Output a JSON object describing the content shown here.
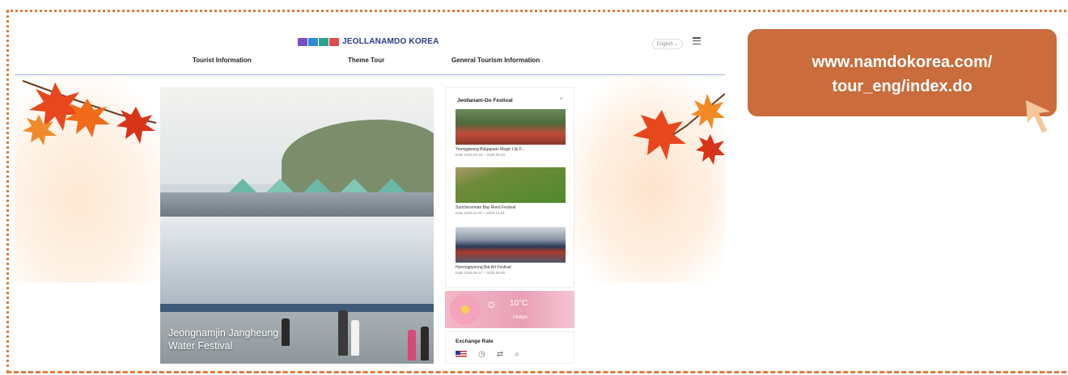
{
  "header": {
    "logo_text": "JEOLLANAMDO KOREA",
    "language": "English ⌄",
    "nav": [
      "Tourist Information",
      "Theme Tour",
      "General Tourism Information"
    ]
  },
  "hero": {
    "caption_line1": "Jeongnamjin Jangheung",
    "caption_line2": "Water Festival"
  },
  "festival": {
    "title": "Jeollanam-Do Festival",
    "plus": "+",
    "items": [
      {
        "name": "Yeonggwang Bulgapsan Magic Lily F...",
        "date": "Date 2025.09.18 ~ 2025.09.24"
      },
      {
        "name": "Suncheonman Bay Reed Festival",
        "date": "Date 2025.11.02 ~ 2025.12.04"
      },
      {
        "name": "Hyeongpyeong Bat Art Festival",
        "date": "Date 2025.09.27 ~ 2025.09.29"
      }
    ]
  },
  "weather": {
    "temperature": "10°C",
    "city": "Mokpo"
  },
  "exchange": {
    "title": "Exchange Rate"
  },
  "callout": {
    "line1": "www.namdokorea.com/",
    "line2": "tour_eng/index.do"
  },
  "colors": {
    "accent": "#cb6c3c",
    "frame_dots": "#e07b3a",
    "nav_line": "#9fb4d6"
  }
}
